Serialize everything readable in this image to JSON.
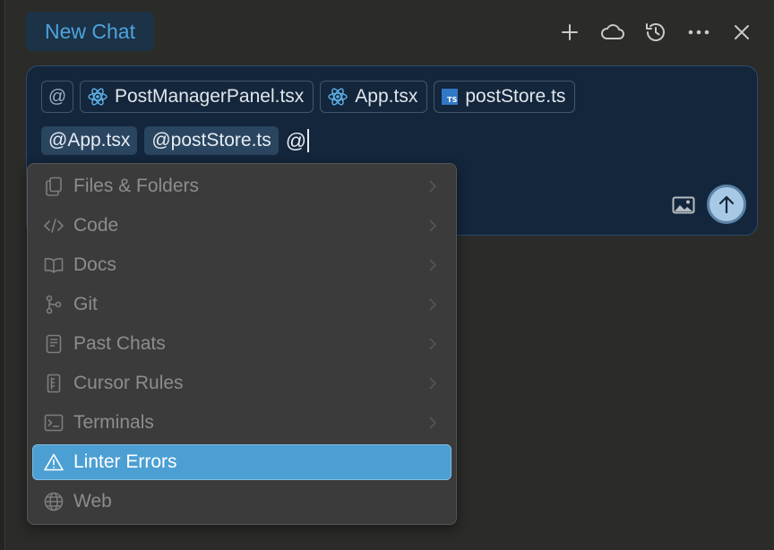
{
  "header": {
    "tab_label": "New Chat",
    "actions": [
      "plus-icon",
      "cloud-icon",
      "history-icon",
      "more-icon",
      "close-icon"
    ]
  },
  "composer": {
    "at_symbol": "@",
    "context_chips": [
      {
        "label": "PostManagerPanel.tsx",
        "icon": "react-icon"
      },
      {
        "label": "App.tsx",
        "icon": "react-icon"
      },
      {
        "label": "postStore.ts",
        "icon": "typescript-icon"
      }
    ],
    "ts_badge": "TS",
    "mentions": [
      "@App.tsx",
      "@postStore.ts"
    ],
    "typed_text": "@"
  },
  "menu": {
    "items": [
      {
        "label": "Files & Folders",
        "icon": "files-icon",
        "submenu": true
      },
      {
        "label": "Code",
        "icon": "code-icon",
        "submenu": true
      },
      {
        "label": "Docs",
        "icon": "book-icon",
        "submenu": true
      },
      {
        "label": "Git",
        "icon": "git-branch-icon",
        "submenu": true
      },
      {
        "label": "Past Chats",
        "icon": "chat-history-icon",
        "submenu": true
      },
      {
        "label": "Cursor Rules",
        "icon": "rules-icon",
        "submenu": true
      },
      {
        "label": "Terminals",
        "icon": "terminal-icon",
        "submenu": true
      },
      {
        "label": "Linter Errors",
        "icon": "warning-icon",
        "submenu": false,
        "selected": true
      },
      {
        "label": "Web",
        "icon": "globe-icon",
        "submenu": false
      }
    ]
  },
  "colors": {
    "accent": "#4c9fd3",
    "tab_text": "#4ea3dc",
    "composer_bg": "#13263c",
    "menu_bg": "#3b3b3b"
  }
}
